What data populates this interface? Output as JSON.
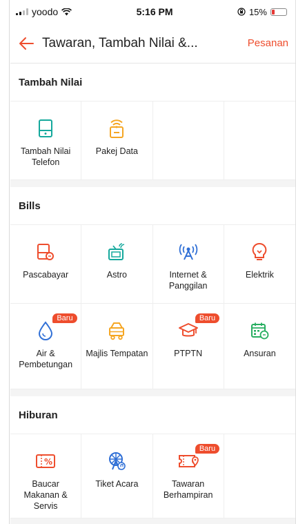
{
  "status": {
    "carrier": "yoodo",
    "time": "5:16 PM",
    "battery": "15%"
  },
  "header": {
    "title": "Tawaran, Tambah Nilai &...",
    "action": "Pesanan"
  },
  "sections": [
    {
      "title": "Tambah Nilai",
      "items": [
        {
          "label": "Tambah Nilai Telefon",
          "icon": "phone-icon"
        },
        {
          "label": "Pakej Data",
          "icon": "data-signal-icon"
        },
        {
          "label": "",
          "icon": ""
        },
        {
          "label": "",
          "icon": ""
        }
      ]
    },
    {
      "title": "Bills",
      "items": [
        {
          "label": "Pascabayar",
          "icon": "postpaid-icon"
        },
        {
          "label": "Astro",
          "icon": "tv-icon"
        },
        {
          "label": "Internet & Panggilan",
          "icon": "antenna-icon"
        },
        {
          "label": "Elektrik",
          "icon": "lightbulb-icon"
        },
        {
          "label": "Air & Pembetungan",
          "icon": "water-drop-icon",
          "badge": "Baru"
        },
        {
          "label": "Majlis Tempatan",
          "icon": "council-cart-icon"
        },
        {
          "label": "PTPTN",
          "icon": "graduation-cap-icon",
          "badge": "Baru"
        },
        {
          "label": "Ansuran",
          "icon": "calendar-icon"
        }
      ]
    },
    {
      "title": "Hiburan",
      "items": [
        {
          "label": "Baucar Makanan & Servis",
          "icon": "voucher-icon"
        },
        {
          "label": "Tiket Acara",
          "icon": "ferris-wheel-icon"
        },
        {
          "label": "Tawaran Berhampiran",
          "icon": "nearby-ticket-icon",
          "badge": "Baru"
        },
        {
          "label": "",
          "icon": ""
        }
      ]
    }
  ],
  "colors": {
    "accent": "#ee4d2d",
    "teal": "#14a89c",
    "orange": "#f5a623",
    "blue": "#2f6fd6",
    "green": "#27ae60"
  }
}
